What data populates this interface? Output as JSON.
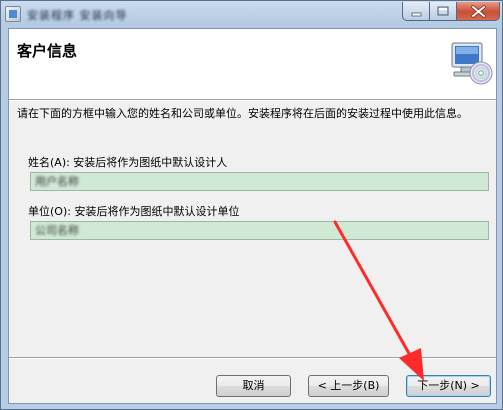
{
  "window": {
    "title": "安装程序 安装向导",
    "colors": {
      "frame": "#b8cfe6",
      "close_button": "#c84f34",
      "field_bg": "#cfe9d4",
      "annotation_arrow": "#ff2a2a"
    }
  },
  "banner": {
    "title": "客户信息",
    "icon": "computer-cd-icon"
  },
  "description": "请在下面的方框中输入您的姓名和公司或单位。安装程序将在后面的安装过程中使用此信息。",
  "form": {
    "name_label": "姓名(A): 安装后将作为图纸中默认设计人",
    "name_value": "用户名称",
    "org_label": "单位(O): 安装后将作为图纸中默认设计单位",
    "org_value": "公司名称"
  },
  "buttons": {
    "cancel": "取消",
    "back": "< 上一步(B)",
    "next": "下一步(N) >"
  }
}
